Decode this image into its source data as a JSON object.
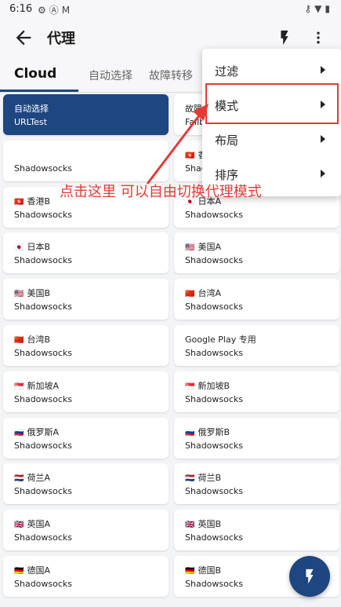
{
  "status_bar": {
    "time": "6:16",
    "left_icons": [
      "gear-icon",
      "a-badge-icon",
      "gmail-icon"
    ],
    "right_icons": [
      "vpn-key-icon",
      "wifi-icon",
      "battery-icon"
    ]
  },
  "app_bar": {
    "title": "代理"
  },
  "tabs": [
    {
      "label": "Cloud",
      "active": true
    },
    {
      "label": "自动选择",
      "active": false
    },
    {
      "label": "故障转移",
      "active": false
    }
  ],
  "proxies": [
    {
      "name": "自动选择",
      "type": "URLTest",
      "flag": "",
      "selected": true
    },
    {
      "name": "故障转移",
      "type": "Fallback",
      "flag": "",
      "selected": false
    },
    {
      "name": "",
      "type": "Shadowsocks",
      "flag": "",
      "selected": false
    },
    {
      "name": "香港A",
      "type": "Shadowsocks",
      "flag": "🇭🇰",
      "selected": false
    },
    {
      "name": "香港B",
      "type": "Shadowsocks",
      "flag": "🇭🇰",
      "selected": false
    },
    {
      "name": "日本A",
      "type": "Shadowsocks",
      "flag": "🇯🇵",
      "selected": false
    },
    {
      "name": "日本B",
      "type": "Shadowsocks",
      "flag": "🇯🇵",
      "selected": false
    },
    {
      "name": "美国A",
      "type": "Shadowsocks",
      "flag": "🇺🇸",
      "selected": false
    },
    {
      "name": "美国B",
      "type": "Shadowsocks",
      "flag": "🇺🇸",
      "selected": false
    },
    {
      "name": "台湾A",
      "type": "Shadowsocks",
      "flag": "🇨🇳",
      "selected": false
    },
    {
      "name": "台湾B",
      "type": "Shadowsocks",
      "flag": "🇨🇳",
      "selected": false
    },
    {
      "name": "Google Play 专用",
      "type": "Shadowsocks",
      "flag": "",
      "selected": false
    },
    {
      "name": "新加坡A",
      "type": "Shadowsocks",
      "flag": "🇸🇬",
      "selected": false
    },
    {
      "name": "新加坡B",
      "type": "Shadowsocks",
      "flag": "🇸🇬",
      "selected": false
    },
    {
      "name": "俄罗斯A",
      "type": "Shadowsocks",
      "flag": "🇷🇺",
      "selected": false
    },
    {
      "name": "俄罗斯B",
      "type": "Shadowsocks",
      "flag": "🇷🇺",
      "selected": false
    },
    {
      "name": "荷兰A",
      "type": "Shadowsocks",
      "flag": "🇳🇱",
      "selected": false
    },
    {
      "name": "荷兰B",
      "type": "Shadowsocks",
      "flag": "🇳🇱",
      "selected": false
    },
    {
      "name": "英国A",
      "type": "Shadowsocks",
      "flag": "🇬🇧",
      "selected": false
    },
    {
      "name": "英国B",
      "type": "Shadowsocks",
      "flag": "🇬🇧",
      "selected": false
    },
    {
      "name": "德国A",
      "type": "Shadowsocks",
      "flag": "🇩🇪",
      "selected": false
    },
    {
      "name": "德国B",
      "type": "Shadowsocks",
      "flag": "🇩🇪",
      "selected": false
    }
  ],
  "menu": {
    "items": [
      {
        "label": "过滤"
      },
      {
        "label": "模式"
      },
      {
        "label": "布局"
      },
      {
        "label": "排序"
      }
    ]
  },
  "annotation": {
    "text": "点击这里 可以自由切换代理模式"
  },
  "colors": {
    "accent": "#1e4680",
    "annotation": "#e53935",
    "background": "#f3f4f6"
  }
}
